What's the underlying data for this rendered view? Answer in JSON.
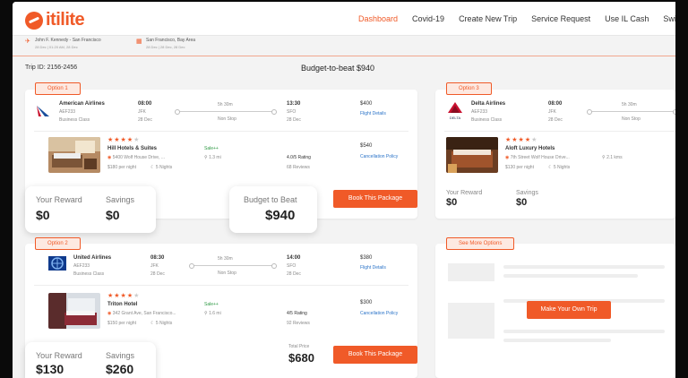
{
  "brand": {
    "name": "itilite",
    "accent": "#f05a28"
  },
  "nav": [
    {
      "label": "Dashboard",
      "active": true
    },
    {
      "label": "Covid-19"
    },
    {
      "label": "Create New Trip"
    },
    {
      "label": "Service Request"
    },
    {
      "label": "Use IL Cash"
    },
    {
      "label": "Switch"
    }
  ],
  "route": {
    "flight": {
      "text": "John F. Kennedy - San Francisco",
      "sub": "28 Dec | 01:20 AM, 28 Dec"
    },
    "hotel": {
      "text": "San Francisco, Bay Area",
      "sub": "28 Dec | 28 Dec, 28 Dec"
    }
  },
  "trip_id": "Trip ID: 2156-2456",
  "budget_title": "Budget-to-beat $940",
  "option1": {
    "tag": "Option 1",
    "airline": "American Airlines",
    "flight_no": "AEF233",
    "class": "Business Class",
    "dep_time": "08:00",
    "dep_code": "JFK",
    "dep_date": "28 Dec",
    "duration": "5h 30m",
    "stops": "Non Stop",
    "arr_time": "13:30",
    "arr_code": "SFO",
    "arr_date": "28 Dec",
    "flight_price": "$400",
    "flight_link": "Flight Details",
    "hotel_name": "Hill Hotels & Suites",
    "hotel_addr": "5400 Wolf House Drive, ...",
    "hotel_rate": "$180 per night",
    "hotel_nights": "5 Nights",
    "sale": "Sale++",
    "distance": "1.3 mi",
    "rating": "4.0/5 Rating",
    "reviews": "68 Reviews",
    "hotel_price": "$540",
    "hotel_link": "Cancellation Policy",
    "stars": 4,
    "reward_label": "Your Reward",
    "reward_value": "$0",
    "savings_label": "Savings",
    "savings_value": "$0",
    "btb_label": "Budget to Beat",
    "btb_value": "$940",
    "book": "Book This Package"
  },
  "option2": {
    "tag": "Option 2",
    "airline": "United Airlines",
    "flight_no": "AEF233",
    "class": "Business Class",
    "dep_time": "08:30",
    "dep_code": "JFK",
    "dep_date": "28 Dec",
    "duration": "5h 30m",
    "stops": "Non Stop",
    "arr_time": "14:00",
    "arr_code": "SFO",
    "arr_date": "28 Dec",
    "flight_price": "$380",
    "flight_link": "Flight Details",
    "hotel_name": "Triton Hotel",
    "hotel_addr": "342 Grant Ave, San Francisco...",
    "hotel_rate": "$150 per night",
    "hotel_nights": "5 Nights",
    "sale": "Sale++",
    "distance": "1.6 mi",
    "rating": "4/5 Rating",
    "reviews": "92 Reviews",
    "hotel_price": "$300",
    "hotel_link": "Cancellation Policy",
    "stars": 4,
    "reward_label": "Your Reward",
    "reward_value": "$130",
    "savings_label": "Savings",
    "savings_value": "$260",
    "total_label": "Total Price",
    "total_value": "$680",
    "book": "Book This Package"
  },
  "option3": {
    "tag": "Option 3",
    "airline": "Delta Airlines",
    "flight_no": "AEF233",
    "class": "Business Class",
    "dep_time": "08:00",
    "dep_code": "JFK",
    "dep_date": "28 Dec",
    "duration": "5h 30m",
    "stops": "Non Stop",
    "hotel_name": "Aloft Luxury Hotels",
    "hotel_addr": "7th Street Wolf House Drive...",
    "hotel_rate": "$130 per night",
    "hotel_nights": "5 Nights",
    "distance": "2.1 kms",
    "stars": 4,
    "reward_label": "Your Reward",
    "reward_value": "$0",
    "savings_label": "Savings",
    "savings_value": "$0"
  },
  "see_more": {
    "tag": "See More Options",
    "button": "Make Your Own Trip"
  }
}
